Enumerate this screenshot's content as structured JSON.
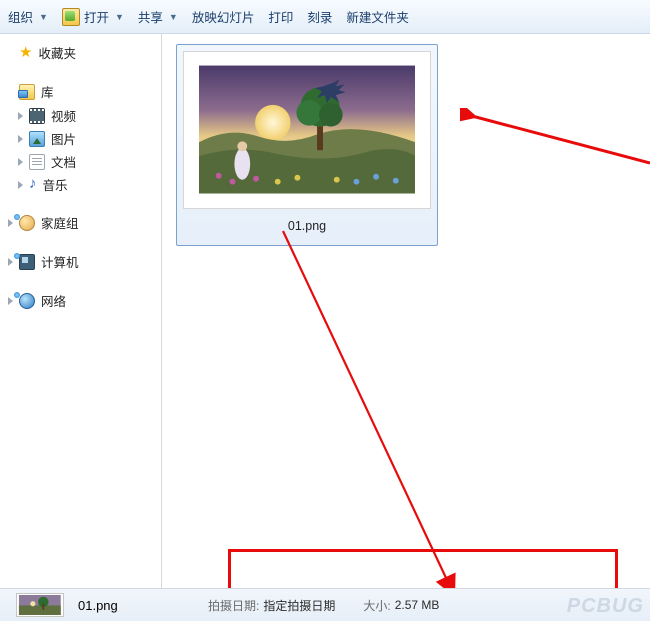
{
  "toolbar": {
    "organize": "组织",
    "open": "打开",
    "share": "共享",
    "slideshow": "放映幻灯片",
    "print": "打印",
    "burn": "刻录",
    "newfolder": "新建文件夹"
  },
  "sidebar": {
    "favorites": "收藏夹",
    "libraries": "库",
    "lib_items": {
      "video": "视频",
      "pictures": "图片",
      "documents": "文档",
      "music": "音乐"
    },
    "homegroup": "家庭组",
    "computer": "计算机",
    "network": "网络"
  },
  "file": {
    "name": "01.png"
  },
  "details": {
    "filename": "01.png",
    "date_label": "拍摄日期:",
    "date_value": "指定拍摄日期",
    "size_label": "大小:",
    "size_value": "2.57 MB"
  },
  "watermark": "PCBUG"
}
